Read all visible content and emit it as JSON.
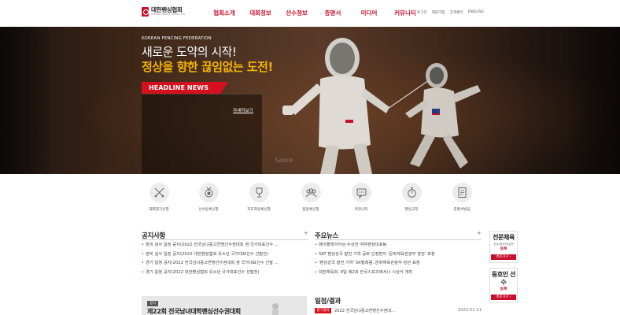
{
  "header": {
    "logo_ko": "대한펜싱협회",
    "logo_en": "KOREAN FENCING FEDERATION",
    "nav": [
      "협회소개",
      "대회정보",
      "선수정보",
      "증명서",
      "미디어",
      "커뮤니티"
    ],
    "util": [
      "로그인",
      "회원가입",
      "고객센터",
      "ENGLISH"
    ]
  },
  "hero": {
    "kicker": "KOREAN FENCING FEDERATION",
    "line1": "새로운 도약의 시작!",
    "line2": "정상을 향한 끊임없는 도전!",
    "headline_tab": "HEADLINE NEWS",
    "more": "자세히보기",
    "watermark": "Sabre"
  },
  "quick_menu": [
    {
      "label": "대회참가신청",
      "icon": "crossed-swords-icon"
    },
    {
      "label": "선수등록신청",
      "icon": "medal-icon"
    },
    {
      "label": "지도자등록신청",
      "icon": "trophy-icon"
    },
    {
      "label": "팀등록신청",
      "icon": "team-icon"
    },
    {
      "label": "커뮤니티",
      "icon": "chat-icon"
    },
    {
      "label": "펜싱규칙",
      "icon": "stopwatch-icon"
    },
    {
      "label": "증명서발급",
      "icon": "document-icon"
    }
  ],
  "notice": {
    "title": "공지사항",
    "plus": "+",
    "items": [
      "장비 검사 일정 공지(2022 전국남녀중고연맹선수권대회 겸 국가대표선수 ...",
      "장비 검사 일정 공지(2022 대한펜싱협회 유소년 국가대표선수 선발전)",
      "경기 일정 공지(2022 전국남녀중고연맹선수권대회 겸 국가대표선수 선발 ...",
      "경기 일정 공지(2022 대한펜싱협회 유소년 국가대표선수 선발전)"
    ]
  },
  "news": {
    "title": "주요뉴스",
    "plus": "+",
    "items": [
      "메이플레이어상-수상한 여자펜싱대표팀",
      "SKT 펜싱강국 발전 기여 공로 인정받아 '문화체육관광부 장관' 표창",
      "'펜싱강국 발전 기여' SK텔레콤, 문화체육관광부 장관 표창",
      "대한체육회, 8일 제2회 한국스포츠에서나 시상식 개최"
    ]
  },
  "promo": {
    "tag": "공식",
    "title": "제22회 전국남녀대학펜싱선수권대회"
  },
  "schedule": {
    "title": "일정/결과",
    "badge": "경기결과",
    "item": "2022 전국남녀중고연맹선수권대...",
    "date": "2022-01-21"
  },
  "side_banners": [
    {
      "big": "전문체육",
      "small": "선수/지도자/심판",
      "red": "등록",
      "link": "바로가기 ›"
    },
    {
      "big": "동호인 선수",
      "small": "",
      "red": "등록",
      "link": "바로가기 ›"
    }
  ]
}
